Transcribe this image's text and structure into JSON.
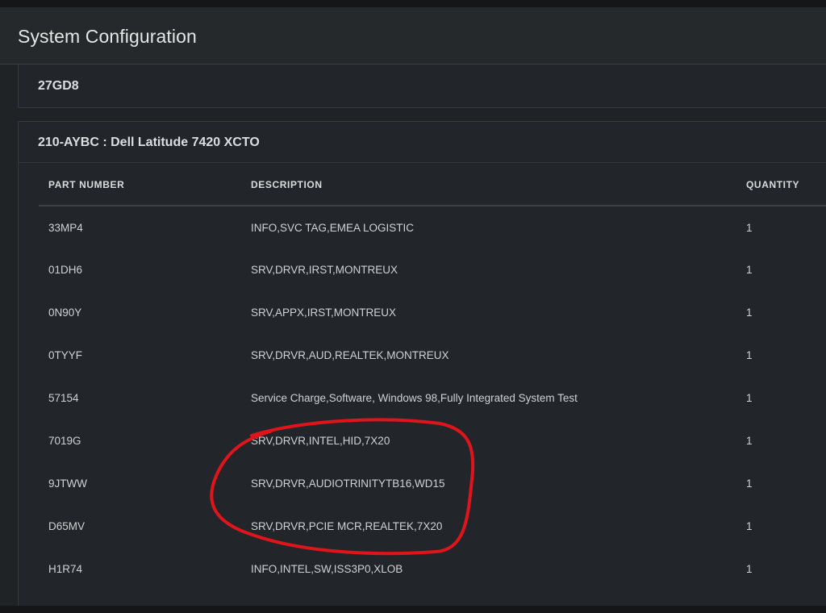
{
  "header": {
    "title": "System Configuration"
  },
  "panels": [
    {
      "title": "27GD8"
    },
    {
      "title": "210-AYBC : Dell Latitude 7420 XCTO"
    }
  ],
  "table": {
    "columns": [
      "PART NUMBER",
      "DESCRIPTION",
      "QUANTITY"
    ],
    "rows": [
      {
        "part": "33MP4",
        "description": "INFO,SVC TAG,EMEA LOGISTIC",
        "quantity": "1"
      },
      {
        "part": "01DH6",
        "description": "SRV,DRVR,IRST,MONTREUX",
        "quantity": "1"
      },
      {
        "part": "0N90Y",
        "description": "SRV,APPX,IRST,MONTREUX",
        "quantity": "1"
      },
      {
        "part": "0TYYF",
        "description": "SRV,DRVR,AUD,REALTEK,MONTREUX",
        "quantity": "1"
      },
      {
        "part": "57154",
        "description": "Service Charge,Software, Windows 98,Fully Integrated System Test",
        "quantity": "1"
      },
      {
        "part": "7019G",
        "description": "SRV,DRVR,INTEL,HID,7X20",
        "quantity": "1"
      },
      {
        "part": "9JTWW",
        "description": "SRV,DRVR,AUDIOTRINITYTB16,WD15",
        "quantity": "1"
      },
      {
        "part": "D65MV",
        "description": "SRV,DRVR,PCIE MCR,REALTEK,7X20",
        "quantity": "1"
      },
      {
        "part": "H1R74",
        "description": "INFO,INTEL,SW,ISS3P0,XLOB",
        "quantity": "1"
      }
    ]
  },
  "annotation": {
    "color": "#e0141b",
    "shape": "hand-drawn-ellipse"
  }
}
